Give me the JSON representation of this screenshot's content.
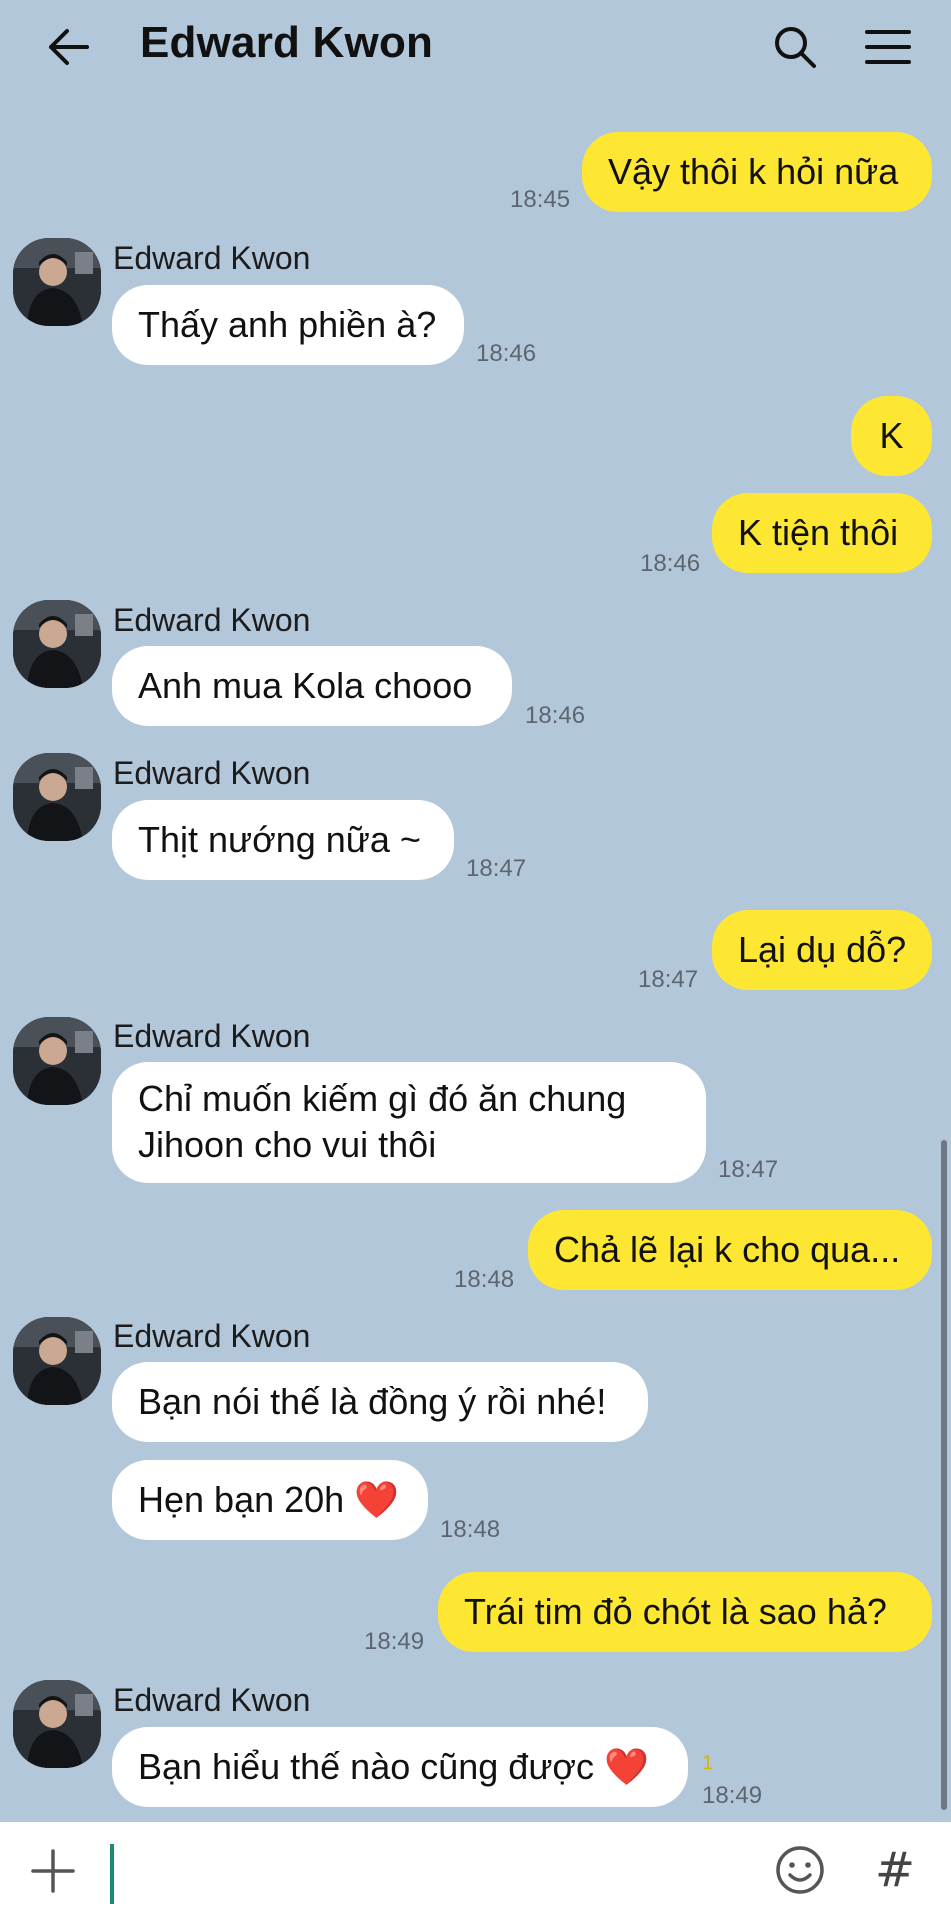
{
  "header": {
    "title": "Edward Kwon",
    "back_icon": "arrow-left-icon",
    "search_icon": "search-icon",
    "menu_icon": "hamburger-menu-icon"
  },
  "messages": [
    {
      "side": "me",
      "text": "Vậy thôi k hỏi nữa",
      "time": "18:45"
    },
    {
      "side": "them",
      "sender": "Edward Kwon",
      "text": "Thấy anh phiền à?",
      "time": "18:46"
    },
    {
      "side": "me",
      "text": "K",
      "time": ""
    },
    {
      "side": "me",
      "text": "K tiện thôi",
      "time": "18:46"
    },
    {
      "side": "them",
      "sender": "Edward Kwon",
      "text": "Anh mua Kola chooo",
      "time": "18:46"
    },
    {
      "side": "them",
      "sender": "Edward Kwon",
      "text": "Thịt nướng nữa ~",
      "time": "18:47"
    },
    {
      "side": "me",
      "text": "Lại dụ dỗ?",
      "time": "18:47"
    },
    {
      "side": "them",
      "sender": "Edward Kwon",
      "text": "Chỉ muốn kiếm gì đó ăn chung Jihoon cho vui thôi",
      "time": "18:47"
    },
    {
      "side": "me",
      "text": "Chả lẽ lại k cho qua...",
      "time": "18:48"
    },
    {
      "side": "them",
      "sender": "Edward Kwon",
      "text": "Bạn nói thế là đồng ý rồi nhé!",
      "time": ""
    },
    {
      "side": "them",
      "text": "Hẹn bạn 20h ❤️",
      "time": "18:48"
    },
    {
      "side": "me",
      "text": "Trái tim đỏ chót là sao hả?",
      "time": "18:49"
    },
    {
      "side": "them",
      "sender": "Edward Kwon",
      "text": "Bạn hiểu thế nào cũng được ❤️",
      "time": "18:49",
      "unread": "1"
    }
  ],
  "input": {
    "placeholder": "",
    "value": "",
    "plus_icon": "plus-icon",
    "emoji_icon": "emoji-icon",
    "hash_label": "#"
  },
  "colors": {
    "background": "#b3c7da",
    "my_bubble": "#fde733",
    "their_bubble": "#ffffff",
    "caret": "#1f8a74"
  }
}
